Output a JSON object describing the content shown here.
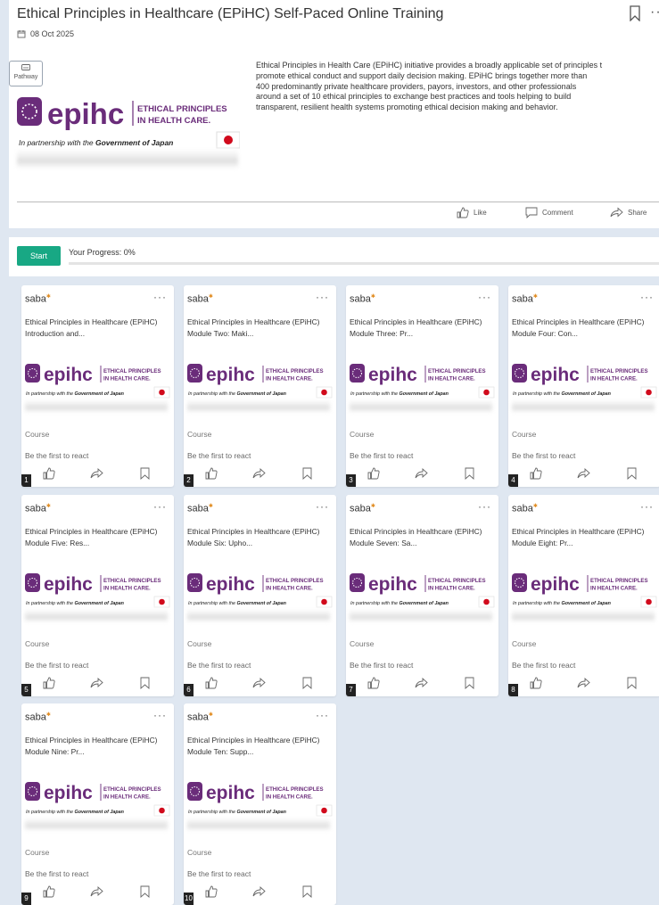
{
  "page": {
    "title": "Ethical Principles in Healthcare (EPiHC) Self-Paced Online Training",
    "date": "08 Oct 2025",
    "pathway_label": "Pathway",
    "description_lines": [
      "Ethical Principles in Health Care (EPiHC) initiative provides a broadly applicable set of principles t",
      "promote ethical conduct and support daily decision making. EPiHC brings together more than",
      "400 predominantly private healthcare providers, payors, investors, and other professionals",
      "around a set of 10 ethical principles to exchange best practices and tools helping to build",
      "transparent, resilient health systems promoting ethical decision making and behavior."
    ],
    "actions": {
      "like": "Like",
      "comment": "Comment",
      "share": "Share"
    }
  },
  "logo": {
    "brand": "epihc",
    "tagline_1": "ETHICAL PRINCIPLES",
    "tagline_2": "IN HEALTH CARE.",
    "partnership_prefix": "In partnership with the ",
    "partnership_strong": "Government of Japan"
  },
  "progress": {
    "start_label": "Start",
    "label": "Your Progress: 0%",
    "percent": 0
  },
  "colors": {
    "accent": "#18a884",
    "brand_purple": "#6a2c7a",
    "japan_red": "#d10a1c"
  },
  "cards": [
    {
      "num": "1",
      "provider": "saba",
      "line1": "Ethical Principles in Healthcare (EPiHC)",
      "line2": "Introduction and...",
      "type": "Course",
      "react": "Be the first to react"
    },
    {
      "num": "2",
      "provider": "saba",
      "line1": "Ethical Principles in Healthcare (EPiHC)",
      "line2": "Module Two: Maki...",
      "type": "Course",
      "react": "Be the first to react"
    },
    {
      "num": "3",
      "provider": "saba",
      "line1": "Ethical Principles in Healthcare (EPiHC)",
      "line2": "Module Three: Pr...",
      "type": "Course",
      "react": "Be the first to react"
    },
    {
      "num": "4",
      "provider": "saba",
      "line1": "Ethical Principles in Healthcare (EPiHC)",
      "line2": "Module Four: Con...",
      "type": "Course",
      "react": "Be the first to react"
    },
    {
      "num": "5",
      "provider": "saba",
      "line1": "Ethical Principles in Healthcare (EPiHC)",
      "line2": "Module Five: Res...",
      "type": "Course",
      "react": "Be the first to react"
    },
    {
      "num": "6",
      "provider": "saba",
      "line1": "Ethical Principles in Healthcare (EPiHC)",
      "line2": "Module Six: Upho...",
      "type": "Course",
      "react": "Be the first to react"
    },
    {
      "num": "7",
      "provider": "saba",
      "line1": "Ethical Principles in Healthcare (EPiHC)",
      "line2": "Module Seven: Sa...",
      "type": "Course",
      "react": "Be the first to react"
    },
    {
      "num": "8",
      "provider": "saba",
      "line1": "Ethical Principles in Healthcare (EPiHC)",
      "line2": "Module Eight: Pr...",
      "type": "Course",
      "react": "Be the first to react"
    },
    {
      "num": "9",
      "provider": "saba",
      "line1": "Ethical Principles in Healthcare (EPiHC)",
      "line2": "Module Nine: Pr...",
      "type": "Course",
      "react": "Be the first to react"
    },
    {
      "num": "10",
      "provider": "saba",
      "line1": "Ethical Principles in Healthcare (EPiHC)",
      "line2": "Module Ten: Supp...",
      "type": "Course",
      "react": "Be the first to react"
    }
  ]
}
